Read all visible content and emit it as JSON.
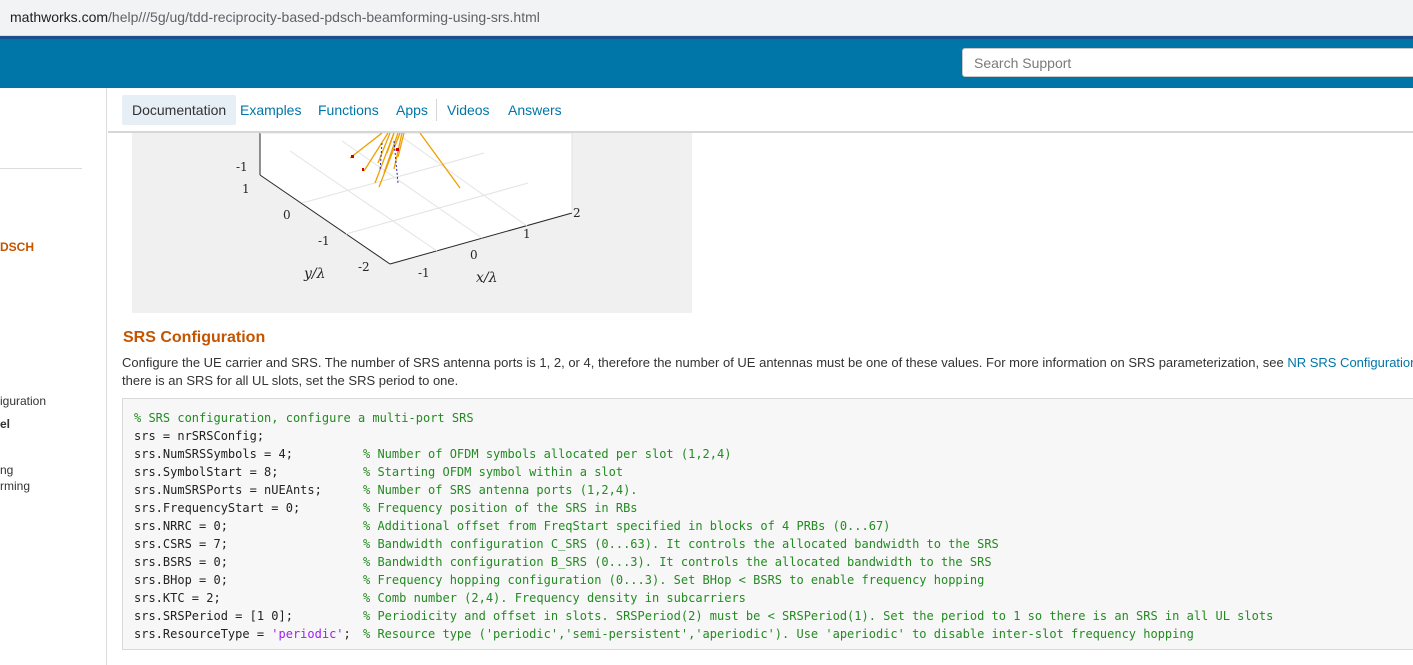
{
  "browser": {
    "url_host": "mathworks.com",
    "url_path": "/help///5g/ug/tdd-reciprocity-based-pdsch-beamforming-using-srs.html"
  },
  "header": {
    "search_placeholder": "Search Support",
    "accent_color": "#0076a8"
  },
  "sidebar": {
    "items": [
      {
        "label": "DSCH",
        "style": "active"
      },
      {
        "label": "iguration",
        "style": "normal"
      },
      {
        "label": "el",
        "style": "bold"
      },
      {
        "label": "ng",
        "style": "normal"
      },
      {
        "label": "rming",
        "style": "normal"
      }
    ]
  },
  "tabs": [
    {
      "label": "Documentation",
      "active": true
    },
    {
      "label": "Examples",
      "active": false
    },
    {
      "label": "Functions",
      "active": false
    },
    {
      "label": "Apps",
      "active": false
    },
    {
      "label": "Videos",
      "active": false
    },
    {
      "label": "Answers",
      "active": false
    }
  ],
  "plot": {
    "ylabel": "y/λ",
    "xlabel": "x/λ",
    "z_ticks": [
      "-1",
      "1"
    ],
    "y_ticks": [
      "0",
      "-1",
      "-2"
    ],
    "x_ticks": [
      "-1",
      "0",
      "1",
      "2"
    ]
  },
  "section": {
    "title": "SRS Configuration",
    "para_line1": "Configure the UE carrier and SRS. The number of SRS antenna ports is 1, 2, or 4, therefore the number of UE antennas must be one of these values. For more information on SRS parameterization, see ",
    "para_link": "NR SRS Configuration",
    "para_line2": "there is an SRS for all UL slots, set the SRS period to one."
  },
  "code": {
    "header_comment": "% SRS configuration, configure a multi-port SRS",
    "line_config": "srs = nrSRSConfig;",
    "lines": [
      {
        "lhs": "srs.NumSRSSymbols = 4;",
        "comment": "% Number of OFDM symbols allocated per slot (1,2,4)"
      },
      {
        "lhs": "srs.SymbolStart = 8;",
        "comment": "% Starting OFDM symbol within a slot"
      },
      {
        "lhs": "srs.NumSRSPorts = nUEAnts;",
        "comment": "% Number of SRS antenna ports (1,2,4)."
      },
      {
        "lhs": "srs.FrequencyStart = 0;",
        "comment": "% Frequency position of the SRS in RBs"
      },
      {
        "lhs": "srs.NRRC = 0;",
        "comment": "% Additional offset from FreqStart specified in blocks of 4 PRBs (0...67)"
      },
      {
        "lhs": "srs.CSRS = 7;",
        "comment": "% Bandwidth configuration C_SRS (0...63). It controls the allocated bandwidth to the SRS"
      },
      {
        "lhs": "srs.BSRS = 0;",
        "comment": "% Bandwidth configuration B_SRS (0...3). It controls the allocated bandwidth to the SRS"
      },
      {
        "lhs": "srs.BHop = 0;",
        "comment": "% Frequency hopping configuration (0...3). Set BHop < BSRS to enable frequency hopping"
      },
      {
        "lhs": "srs.KTC = 2;",
        "comment": "% Comb number (2,4). Frequency density in subcarriers"
      },
      {
        "lhs": "srs.SRSPeriod = [1 0];",
        "comment": "% Periodicity and offset in slots. SRSPeriod(2) must be < SRSPeriod(1). Set the period to 1 so there is an SRS in all UL slots"
      }
    ],
    "last_lhs_prefix": "srs.ResourceType = ",
    "last_lhs_string": "'periodic'",
    "last_lhs_suffix": ";",
    "last_comment": "% Resource type ('periodic','semi-persistent','aperiodic'). Use 'aperiodic' to disable inter-slot frequency hopping"
  }
}
